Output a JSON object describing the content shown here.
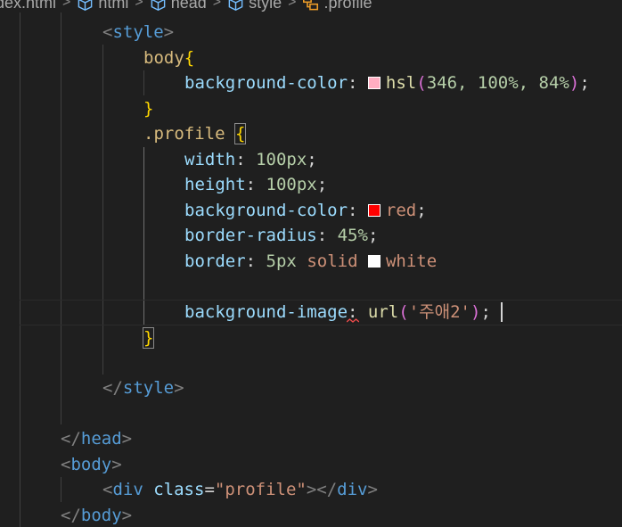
{
  "breadcrumb": {
    "items": [
      {
        "label": "dex.html",
        "icon": "html-file-icon"
      },
      {
        "label": "html",
        "icon": "cube-icon"
      },
      {
        "label": "head",
        "icon": "cube-icon"
      },
      {
        "label": "style",
        "icon": "cube-icon"
      },
      {
        "label": ".profile",
        "icon": "css-selector-icon"
      }
    ],
    "separator": ">"
  },
  "code": {
    "style_open_tag": "style",
    "body_selector": "body",
    "open_brace": "{",
    "close_brace": "}",
    "bg_color_prop": "background-color",
    "hsl_fn": "hsl",
    "hsl_args": "346, 100%, 84%",
    "profile_selector": ".profile",
    "width_prop": "width",
    "width_val": "100px",
    "height_prop": "height",
    "height_val": "100px",
    "bg_color_val": "red",
    "radius_prop": "border-radius",
    "radius_val": "45%",
    "border_prop": "border",
    "border_width": "5px",
    "border_style": "solid",
    "border_color": "white",
    "bg_image_prop": "background-image",
    "url_fn": "url",
    "url_arg": "'주애2'",
    "style_close_tag": "style",
    "head_close_tag": "head",
    "body_open_tag": "body",
    "div_tag": "div",
    "class_attr": "class",
    "class_val": "\"profile\"",
    "body_close_tag": "body"
  },
  "colors": {
    "hsl_swatch": "#ffadc1",
    "red_swatch": "#ff0000",
    "white_swatch": "#ffffff"
  }
}
